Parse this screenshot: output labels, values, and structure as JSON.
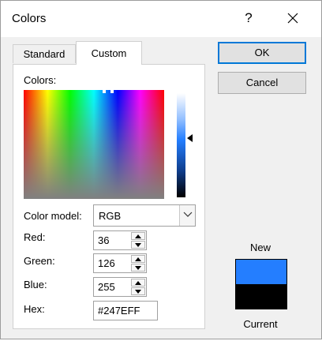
{
  "dialog": {
    "title": "Colors"
  },
  "titlebar": {
    "help_label": "?"
  },
  "tabs": [
    {
      "label": "Standard",
      "selected": false
    },
    {
      "label": "Custom",
      "selected": true
    }
  ],
  "custom": {
    "colors_label": "Colors:",
    "color_model": {
      "label": "Color model:",
      "value": "RGB"
    },
    "red": {
      "label": "Red:",
      "value": "36"
    },
    "green": {
      "label": "Green:",
      "value": "126"
    },
    "blue": {
      "label": "Blue:",
      "value": "255"
    },
    "hex": {
      "label": "Hex:",
      "value": "#247EFF"
    }
  },
  "buttons": {
    "ok": "OK",
    "cancel": "Cancel"
  },
  "preview": {
    "new_label": "New",
    "current_label": "Current",
    "new_color": "#247EFF",
    "current_color": "#000000"
  },
  "colors": {
    "accent": "#0078D7"
  }
}
